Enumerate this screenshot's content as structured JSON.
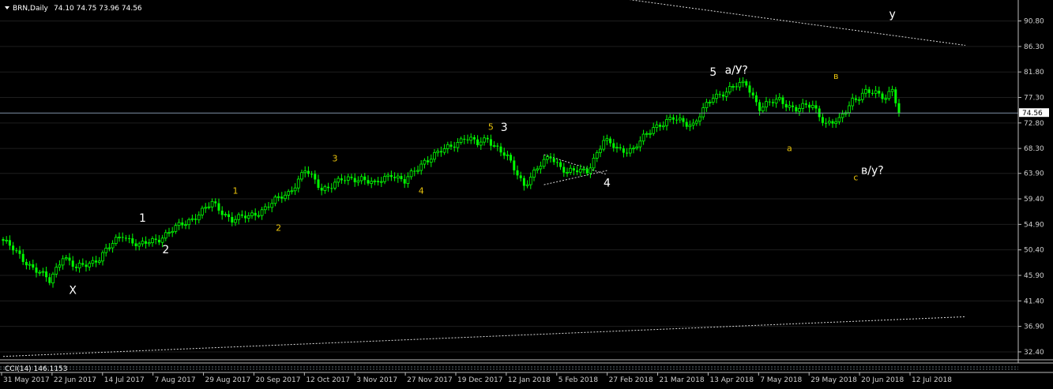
{
  "header": {
    "symbol": "BRN,Daily",
    "ohlc": "74.10 74.75 73.96 74.56"
  },
  "indicator": {
    "label": "CCI(14) 146.1153"
  },
  "colors": {
    "background": "#000000",
    "bull": "#00ff00",
    "bear": "#00ff00",
    "grid": "#1e1e1e",
    "wave_white": "#ffffff",
    "wave_yellow": "#e8c20c",
    "current_price_line": "#7f8fa6"
  },
  "chart_data": {
    "type": "candlestick",
    "current_price": 74.56,
    "ylim": [
      31.0,
      94.5
    ],
    "y_ticks": [
      "90.80",
      "86.30",
      "81.80",
      "77.30",
      "72.80",
      "68.30",
      "63.90",
      "59.40",
      "54.90",
      "50.40",
      "45.90",
      "41.40",
      "36.90",
      "32.40"
    ],
    "x_ticks": [
      "31 May 2017",
      "22 Jun 2017",
      "14 Jul 2017",
      "7 Aug 2017",
      "29 Aug 2017",
      "20 Sep 2017",
      "12 Oct 2017",
      "3 Nov 2017",
      "27 Nov 2017",
      "19 Dec 2017",
      "12 Jan 2018",
      "5 Feb 2018",
      "27 Feb 2018",
      "21 Mar 2018",
      "13 Apr 2018",
      "7 May 2018",
      "29 May 2018",
      "20 Jun 2018",
      "12 Jul 2018"
    ],
    "anchors": [
      {
        "bar": 0,
        "price": 52.0
      },
      {
        "bar": 6,
        "price": 48.8
      },
      {
        "bar": 14,
        "price": 44.8
      },
      {
        "bar": 18,
        "price": 49.5
      },
      {
        "bar": 22,
        "price": 47.0
      },
      {
        "bar": 29,
        "price": 49.0
      },
      {
        "bar": 36,
        "price": 53.2
      },
      {
        "bar": 41,
        "price": 51.0
      },
      {
        "bar": 47,
        "price": 52.5
      },
      {
        "bar": 55,
        "price": 55.2
      },
      {
        "bar": 63,
        "price": 58.5
      },
      {
        "bar": 69,
        "price": 55.8
      },
      {
        "bar": 74,
        "price": 56.2
      },
      {
        "bar": 80,
        "price": 58.2
      },
      {
        "bar": 86,
        "price": 60.5
      },
      {
        "bar": 91,
        "price": 64.4
      },
      {
        "bar": 96,
        "price": 61.2
      },
      {
        "bar": 102,
        "price": 62.6
      },
      {
        "bar": 108,
        "price": 63.2
      },
      {
        "bar": 112,
        "price": 61.8
      },
      {
        "bar": 117,
        "price": 64.0
      },
      {
        "bar": 121,
        "price": 62.3
      },
      {
        "bar": 127,
        "price": 66.2
      },
      {
        "bar": 133,
        "price": 68.0
      },
      {
        "bar": 139,
        "price": 70.3
      },
      {
        "bar": 143,
        "price": 69.0
      },
      {
        "bar": 146,
        "price": 70.2
      },
      {
        "bar": 152,
        "price": 66.5
      },
      {
        "bar": 157,
        "price": 62.0
      },
      {
        "bar": 161,
        "price": 64.6
      },
      {
        "bar": 165,
        "price": 67.0
      },
      {
        "bar": 170,
        "price": 64.0
      },
      {
        "bar": 176,
        "price": 64.5
      },
      {
        "bar": 181,
        "price": 69.5
      },
      {
        "bar": 186,
        "price": 68.2
      },
      {
        "bar": 190,
        "price": 68.0
      },
      {
        "bar": 196,
        "price": 72.2
      },
      {
        "bar": 202,
        "price": 73.4
      },
      {
        "bar": 208,
        "price": 72.6
      },
      {
        "bar": 214,
        "price": 77.3
      },
      {
        "bar": 220,
        "price": 79.2
      },
      {
        "bar": 224,
        "price": 79.6
      },
      {
        "bar": 228,
        "price": 75.6
      },
      {
        "bar": 234,
        "price": 76.8
      },
      {
        "bar": 239,
        "price": 75.3
      },
      {
        "bar": 244,
        "price": 75.8
      },
      {
        "bar": 248,
        "price": 72.8
      },
      {
        "bar": 252,
        "price": 73.0
      },
      {
        "bar": 256,
        "price": 77.0
      },
      {
        "bar": 260,
        "price": 78.2
      },
      {
        "bar": 266,
        "price": 77.5
      },
      {
        "bar": 268,
        "price": 79.0
      },
      {
        "bar": 270,
        "price": 74.56
      }
    ],
    "price_lines": [
      {
        "points": [
          [
            0,
            109.6
          ],
          [
            290,
            86.5
          ]
        ],
        "style": "dotted"
      },
      {
        "points": [
          [
            0,
            31.6
          ],
          [
            290,
            38.6
          ]
        ],
        "style": "dotted"
      },
      {
        "points": [
          [
            163,
            61.9
          ],
          [
            182,
            64.4
          ]
        ],
        "style": "dotted"
      },
      {
        "points": [
          [
            163,
            67.2
          ],
          [
            182,
            63.7
          ]
        ],
        "style": "dotted"
      }
    ],
    "wave_labels": [
      {
        "text": "X",
        "bar": 21,
        "price": 42.6,
        "color": "white",
        "size": "big"
      },
      {
        "text": "1",
        "bar": 42,
        "price": 55.4,
        "color": "white",
        "size": "big"
      },
      {
        "text": "2",
        "bar": 49,
        "price": 49.8,
        "color": "white",
        "size": "big"
      },
      {
        "text": "1",
        "bar": 70,
        "price": 60.3,
        "color": "yellow",
        "size": "small"
      },
      {
        "text": "2",
        "bar": 83,
        "price": 53.8,
        "color": "yellow",
        "size": "small"
      },
      {
        "text": "3",
        "bar": 100,
        "price": 66.0,
        "color": "yellow",
        "size": "small"
      },
      {
        "text": "4",
        "bar": 126,
        "price": 60.3,
        "color": "yellow",
        "size": "small"
      },
      {
        "text": "5",
        "bar": 147,
        "price": 71.6,
        "color": "yellow",
        "size": "small"
      },
      {
        "text": "3",
        "bar": 151,
        "price": 71.4,
        "color": "white",
        "size": "big"
      },
      {
        "text": "4",
        "bar": 182,
        "price": 61.6,
        "color": "white",
        "size": "big"
      },
      {
        "text": "5",
        "bar": 214,
        "price": 81.1,
        "color": "white",
        "size": "big"
      },
      {
        "text": "а/У?",
        "bar": 221,
        "price": 81.5,
        "color": "white",
        "size": "big"
      },
      {
        "text": "а",
        "bar": 237,
        "price": 67.8,
        "color": "yellow",
        "size": "small"
      },
      {
        "text": "в",
        "bar": 251,
        "price": 80.6,
        "color": "yellow",
        "size": "small"
      },
      {
        "text": "с",
        "bar": 257,
        "price": 62.7,
        "color": "yellow",
        "size": "small"
      },
      {
        "text": "в/у?",
        "bar": 262,
        "price": 63.8,
        "color": "white",
        "size": "big"
      },
      {
        "text": "у",
        "bar": 268,
        "price": 91.4,
        "color": "white",
        "size": "big"
      }
    ]
  }
}
